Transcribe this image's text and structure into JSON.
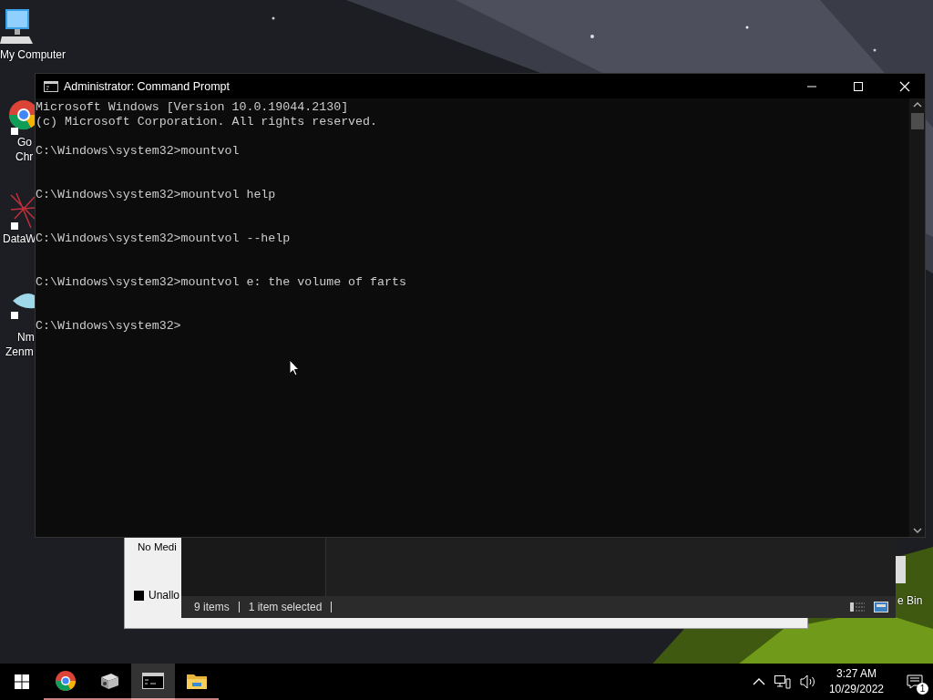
{
  "desktop_icons": [
    {
      "kind": "computer",
      "label_lines": [
        "My Computer"
      ]
    },
    {
      "kind": "chrome",
      "label_lines": [
        "Go",
        "Chr"
      ]
    },
    {
      "kind": "web",
      "label_lines": [
        "DataW"
      ]
    },
    {
      "kind": "eye",
      "label_lines": [
        "Nm",
        "Zenm"
      ]
    }
  ],
  "recycle_bin": {
    "label": "e Bin"
  },
  "disk_window": {
    "media": "No Medi",
    "legend": "Unallo"
  },
  "explorer_window": {
    "status_items": [
      "9 items",
      "1 item selected"
    ]
  },
  "console": {
    "title": "Administrator: Command Prompt",
    "entries": [
      {
        "kind": "header",
        "lines": [
          "Microsoft Windows [Version 10.0.19044.2130]",
          "(c) Microsoft Corporation. All rights reserved."
        ]
      },
      {
        "kind": "command",
        "text": "C:\\Windows\\system32>mountvol"
      },
      {
        "kind": "command",
        "text": "C:\\Windows\\system32>mountvol help"
      },
      {
        "kind": "command",
        "text": "C:\\Windows\\system32>mountvol --help"
      },
      {
        "kind": "command",
        "text": "C:\\Windows\\system32>mountvol e: the volume of farts"
      },
      {
        "kind": "prompt",
        "text": "C:\\Windows\\system32>"
      }
    ]
  },
  "taskbar": {
    "apps": [
      {
        "kind": "chrome",
        "selected": false
      },
      {
        "kind": "tool",
        "selected": false
      },
      {
        "kind": "console",
        "selected": true
      },
      {
        "kind": "folder",
        "selected": false
      }
    ],
    "time": "3:27 AM",
    "date": "10/29/2022",
    "notification_count": "1"
  }
}
